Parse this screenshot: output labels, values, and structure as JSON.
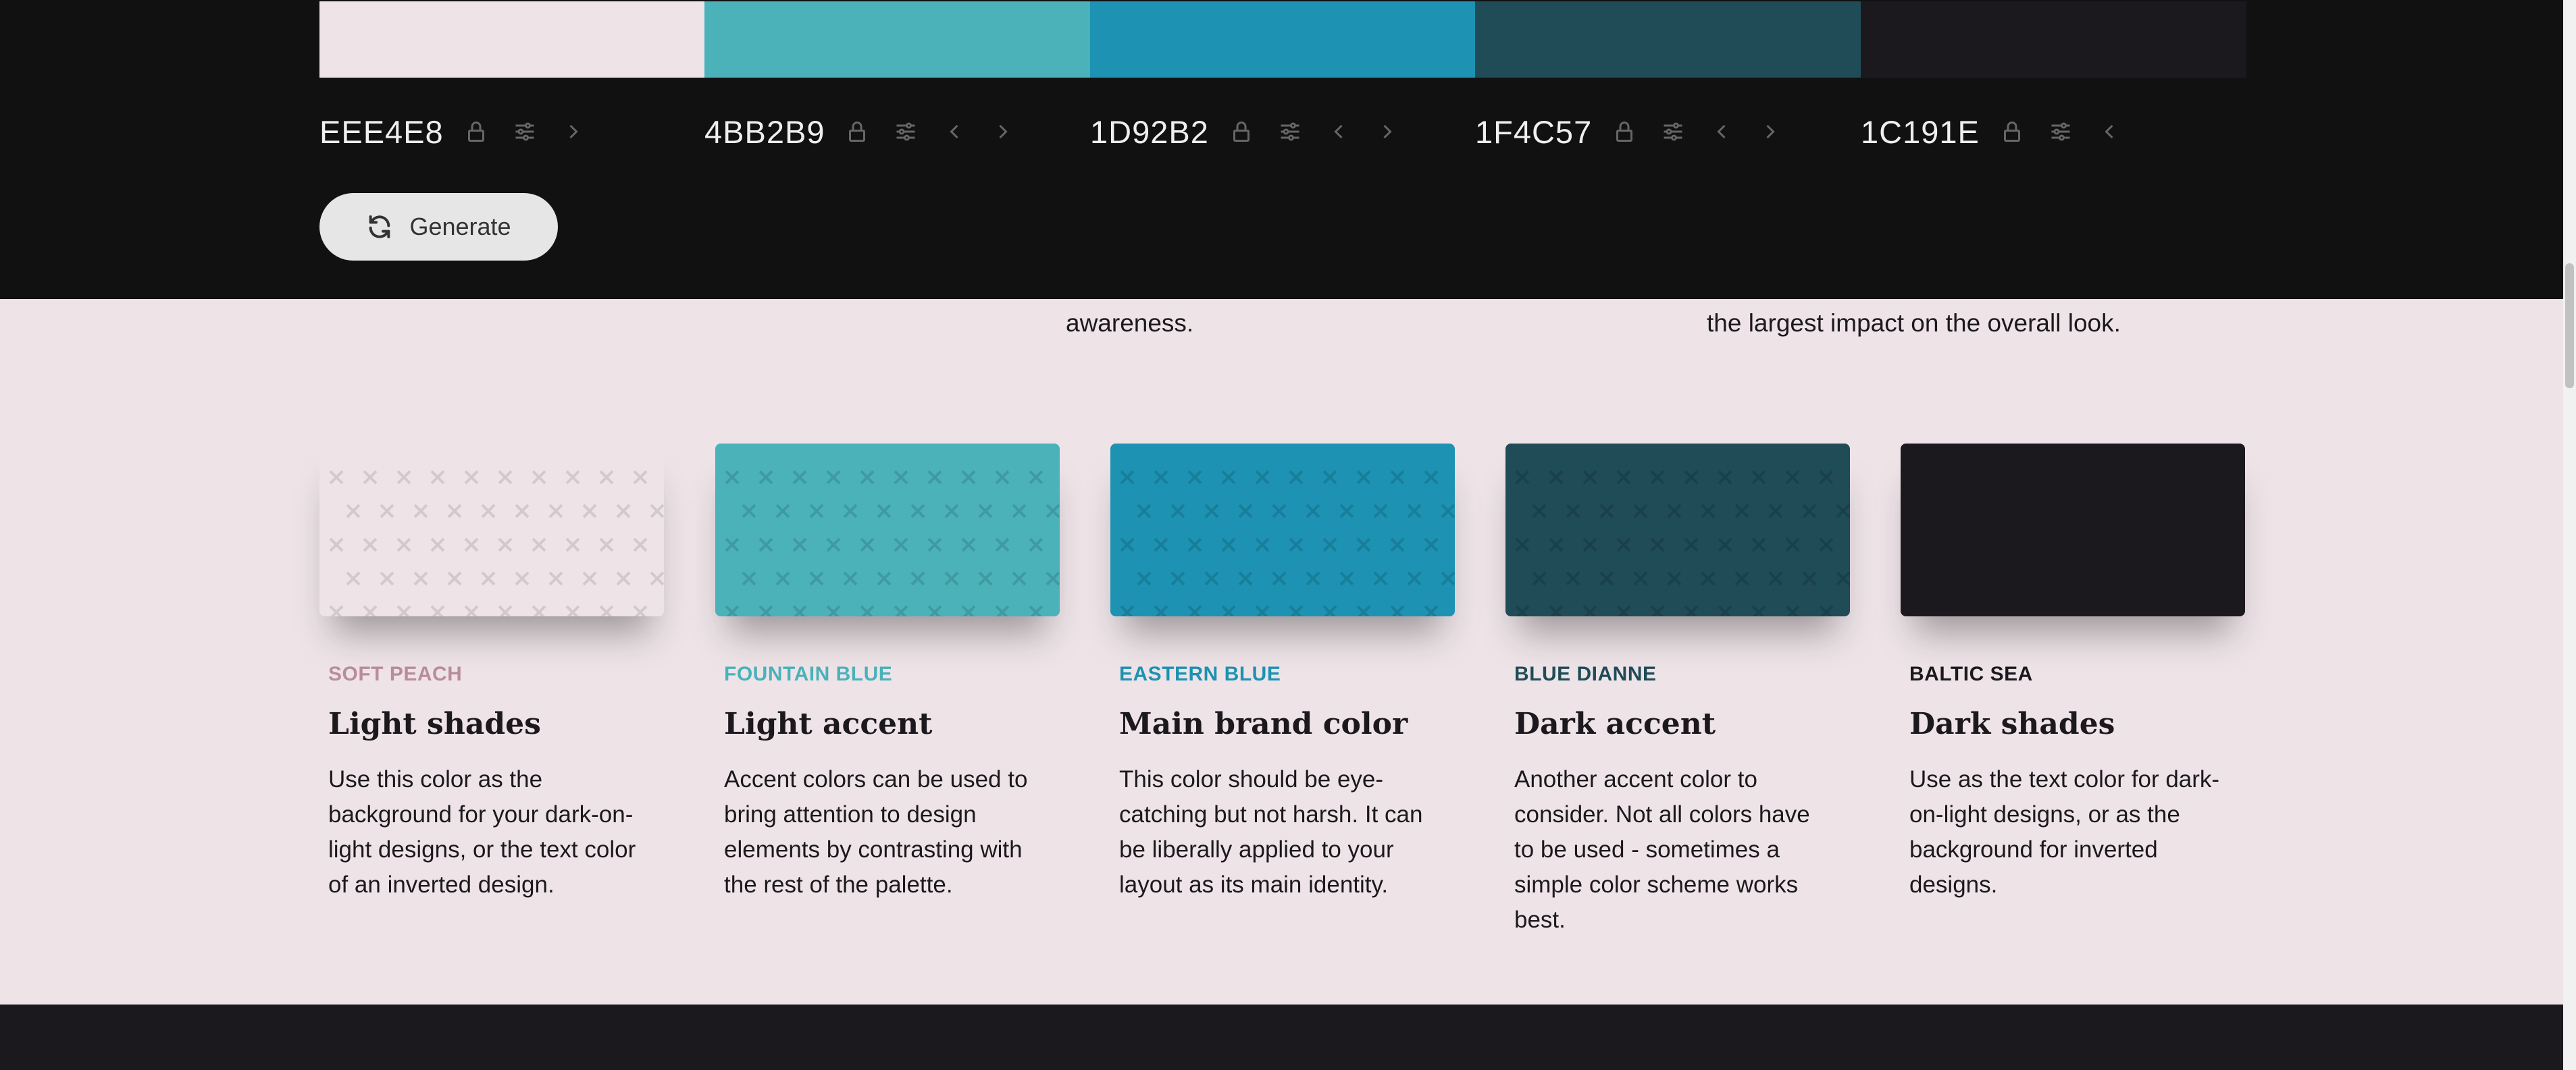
{
  "palette": [
    {
      "hex": "EEE4E8",
      "color": "#EEE4E8",
      "name": "SOFT PEACH",
      "name_color": "#B98C9E",
      "title": "Light shades",
      "desc": "Use this color as the background for your dark-on-light designs, or the text color of an inverted design.",
      "x_color": "#D3C9CD"
    },
    {
      "hex": "4BB2B9",
      "color": "#4BB2B9",
      "name": "FOUNTAIN BLUE",
      "name_color": "#4BB2B9",
      "title": "Light accent",
      "desc": "Accent colors can be used to bring attention to design elements by contrasting with the rest of the palette.",
      "x_color": "#3F9AA1"
    },
    {
      "hex": "1D92B2",
      "color": "#1D92B2",
      "name": "EASTERN BLUE",
      "name_color": "#1D92B2",
      "title": "Main brand color",
      "desc": "This color should be eye-catching but not harsh. It can be liberally applied to your layout as its main identity.",
      "x_color": "#187E9A"
    },
    {
      "hex": "1F4C57",
      "color": "#1F4C57",
      "name": "BLUE DIANNE",
      "name_color": "#1F4C57",
      "title": "Dark accent",
      "desc": "Another accent color to consider. Not all colors have to be used - sometimes a simple color scheme works best.",
      "x_color": "#1A414B"
    },
    {
      "hex": "1C191E",
      "color": "#1C191E",
      "name": "BALTIC SEA",
      "name_color": "#1C191E",
      "title": "Dark shades",
      "desc": "Use as the text color for dark-on-light designs, or as the background for inverted designs.",
      "x_color": "#1C191E"
    }
  ],
  "header": {
    "generate_label": "Generate",
    "icons": [
      "lock-icon",
      "sliders-icon",
      "chevron-left-icon",
      "chevron-right-icon"
    ]
  },
  "peek_text": {
    "a": "awareness.",
    "b": "the largest impact on the overall look."
  }
}
